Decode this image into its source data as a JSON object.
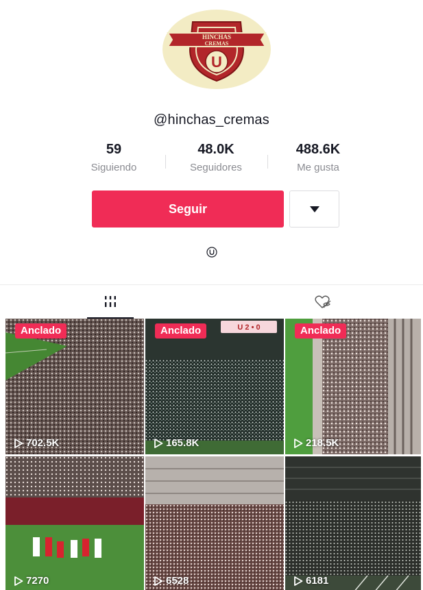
{
  "profile": {
    "username": "@hinchas_cremas",
    "logo_text_top": "HINCHAS",
    "logo_text_bottom": "CREMAS",
    "logo_letter": "U"
  },
  "stats": [
    {
      "value": "59",
      "label": "Siguiendo"
    },
    {
      "value": "48.0K",
      "label": "Seguidores"
    },
    {
      "value": "488.6K",
      "label": "Me gusta"
    }
  ],
  "actions": {
    "follow_label": "Seguir",
    "more_icon": "triangle-down-icon"
  },
  "bio": {
    "icon": "u-circle-icon"
  },
  "tabs": {
    "videos_icon": "grid-bars-icon",
    "liked_icon": "heart-hidden-icon"
  },
  "videos": [
    {
      "pinned": true,
      "badge": "Anclado",
      "views": "702.5K",
      "scene": "stadium-crowd-day"
    },
    {
      "pinned": true,
      "badge": "Anclado",
      "views": "165.8K",
      "scene": "stadium-lights-night",
      "scoreboard": "U 2 • 0"
    },
    {
      "pinned": true,
      "badge": "Anclado",
      "views": "218.5K",
      "scene": "stadium-vertical"
    },
    {
      "pinned": false,
      "badge": "",
      "views": "7270",
      "scene": "players-field"
    },
    {
      "pinned": false,
      "badge": "",
      "views": "6528",
      "scene": "stadium-stands"
    },
    {
      "pinned": false,
      "badge": "",
      "views": "6181",
      "scene": "stadium-dark"
    }
  ],
  "colors": {
    "accent": "#f02c56",
    "text": "#161823",
    "muted": "#8a8b91",
    "logo_red": "#b2262a",
    "logo_bg": "#f3ecc4"
  }
}
